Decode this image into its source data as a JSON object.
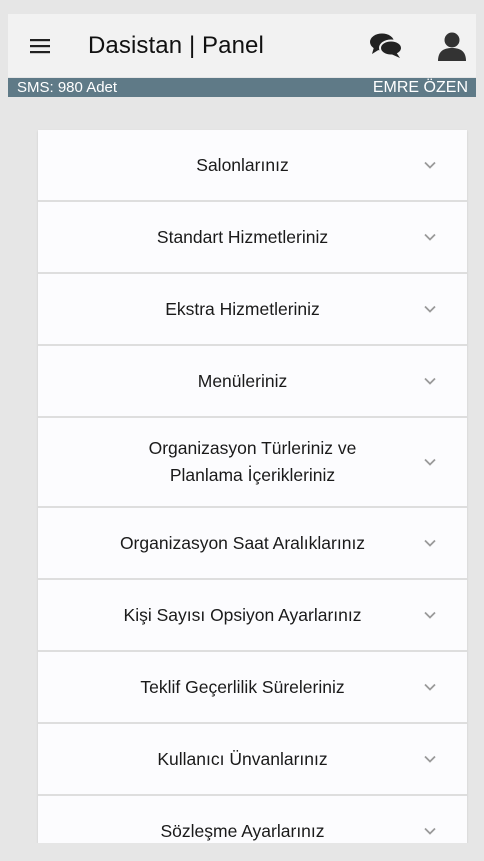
{
  "header": {
    "title": "Dasistan | Panel",
    "menu_icon": "menu-icon",
    "chat_icon": "chat-bubbles-icon",
    "user_icon": "user-icon"
  },
  "status": {
    "sms": "SMS: 980 Adet",
    "user_name": "EMRE ÖZEN",
    "bar_color": "#5f7a87"
  },
  "accordion": {
    "items": [
      {
        "label": "Salonlarınız"
      },
      {
        "label": "Standart Hizmetleriniz"
      },
      {
        "label": "Ekstra Hizmetleriniz"
      },
      {
        "label": "Menüleriniz"
      },
      {
        "label": "Organizasyon Türleriniz ve Planlama İçerikleriniz"
      },
      {
        "label": "Organizasyon Saat Aralıklarınız"
      },
      {
        "label": "Kişi Sayısı Opsiyon Ayarlarınız"
      },
      {
        "label": "Teklif Geçerlilik Süreleriniz"
      },
      {
        "label": "Kullanıcı Ünvanlarınız"
      },
      {
        "label": "Sözleşme Ayarlarınız"
      }
    ]
  }
}
